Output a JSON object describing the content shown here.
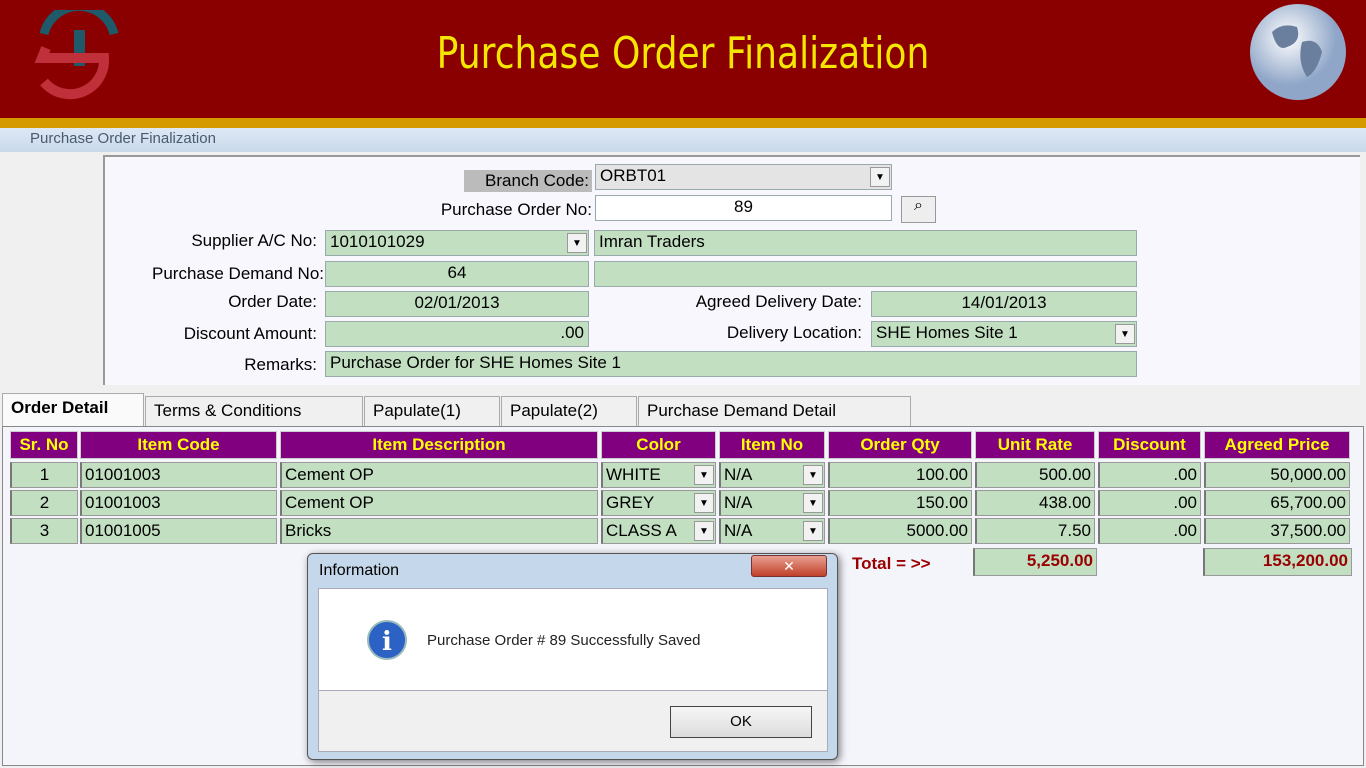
{
  "header": {
    "title": "Purchase Order Finalization",
    "logo": "TS-logo",
    "globe": "globe-icon"
  },
  "window": {
    "title": "Purchase Order Finalization"
  },
  "form": {
    "branch_code_label": "Branch Code:",
    "branch_code": "ORBT01",
    "po_no_label": "Purchase Order No:",
    "po_no": "89",
    "supplier_label": "Supplier A/C No:",
    "supplier_no": "1010101029",
    "supplier_name": "Imran Traders",
    "demand_label": "Purchase Demand No:",
    "demand_no": "64",
    "order_date_label": "Order Date:",
    "order_date": "02/01/2013",
    "agreed_label": "Agreed Delivery Date:",
    "agreed_date": "14/01/2013",
    "discount_label": "Discount Amount:",
    "discount": ".00",
    "location_label": "Delivery Location:",
    "location": "SHE Homes Site 1",
    "remarks_label": "Remarks:",
    "remarks": "Purchase Order for SHE Homes Site 1"
  },
  "tabs": [
    "Order Detail",
    "Terms & Conditions",
    "Papulate(1)",
    "Papulate(2)",
    "Purchase Demand Detail"
  ],
  "table": {
    "headers": [
      "Sr. No",
      "Item Code",
      "Item Description",
      "Color",
      "Item No",
      "Order Qty",
      "Unit Rate",
      "Discount",
      "Agreed Price"
    ],
    "rows": [
      [
        "1",
        "01001003",
        "Cement OP",
        "WHITE",
        "N/A",
        "100.00",
        "500.00",
        ".00",
        "50,000.00"
      ],
      [
        "2",
        "01001003",
        "Cement OP",
        "GREY",
        "N/A",
        "150.00",
        "438.00",
        ".00",
        "65,700.00"
      ],
      [
        "3",
        "01001005",
        "Bricks",
        "CLASS A",
        "N/A",
        "5000.00",
        "7.50",
        ".00",
        "37,500.00"
      ]
    ],
    "total_label": "Total = >>",
    "total_qty": "5,250.00",
    "total_price": "153,200.00"
  },
  "dialog": {
    "title": "Information",
    "message": "Purchase Order # 89 Successfully Saved",
    "ok": "OK",
    "close": "✕"
  },
  "colors": {
    "header": "#8a0000",
    "accent": "#d49a00",
    "grid_header": "#800080",
    "grid_header_text": "#ffff00",
    "field": "#c2dfc2"
  }
}
